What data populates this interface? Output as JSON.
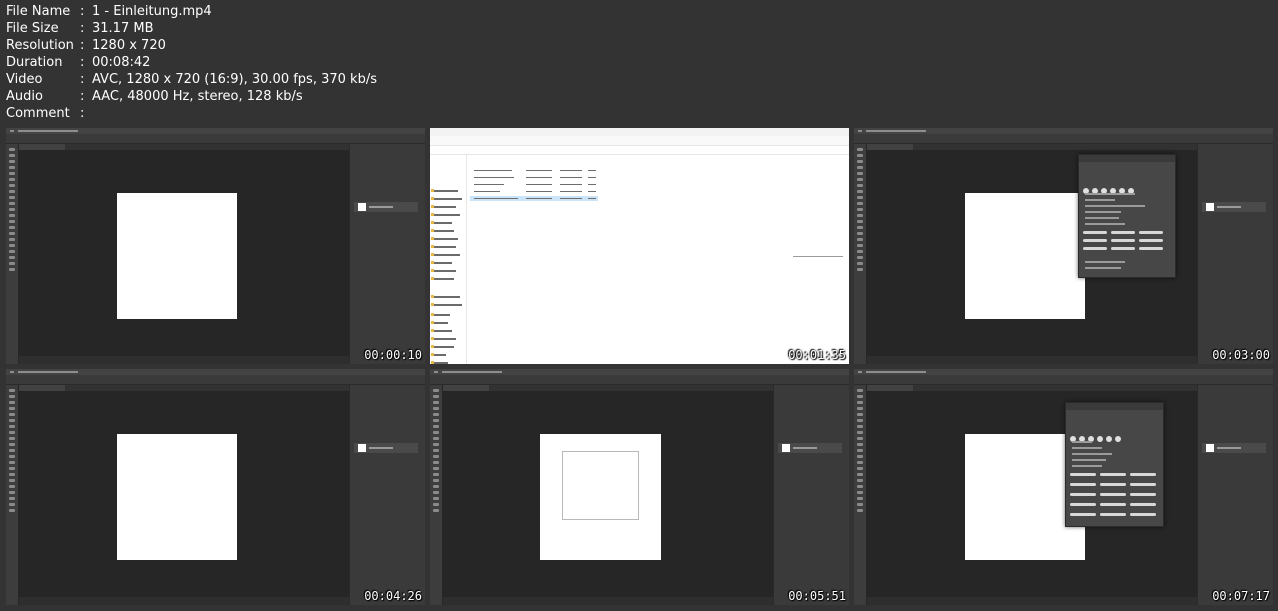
{
  "file_info": [
    {
      "label": "File Name",
      "sep": ":",
      "value": "1 - Einleitung.mp4"
    },
    {
      "label": "File Size",
      "sep": ":",
      "value": "31.17 MB"
    },
    {
      "label": "Resolution",
      "sep": ":",
      "value": "1280 x 720"
    },
    {
      "label": "Duration",
      "sep": ":",
      "value": "00:08:42"
    },
    {
      "label": "Video",
      "sep": ":",
      "value": "AVC, 1280 x 720 (16:9), 30.00 fps, 370 kb/s"
    },
    {
      "label": "Audio",
      "sep": ":",
      "value": "AAC, 48000 Hz, stereo, 128 kb/s"
    },
    {
      "label": "Comment",
      "sep": ":",
      "value": ""
    }
  ],
  "thumbnails": [
    {
      "timestamp": "00:00:10",
      "scene": "photoshop-blank"
    },
    {
      "timestamp": "00:01:35",
      "scene": "file-explorer"
    },
    {
      "timestamp": "00:03:00",
      "scene": "photoshop-brush-panel"
    },
    {
      "timestamp": "00:04:26",
      "scene": "photoshop-blank"
    },
    {
      "timestamp": "00:05:51",
      "scene": "photoshop-selection"
    },
    {
      "timestamp": "00:07:17",
      "scene": "photoshop-brush-panel"
    }
  ],
  "colors": {
    "background": "#333333",
    "text": "#ffffff",
    "ps_canvas": "#262626",
    "ps_chrome": "#3a3a3a"
  }
}
